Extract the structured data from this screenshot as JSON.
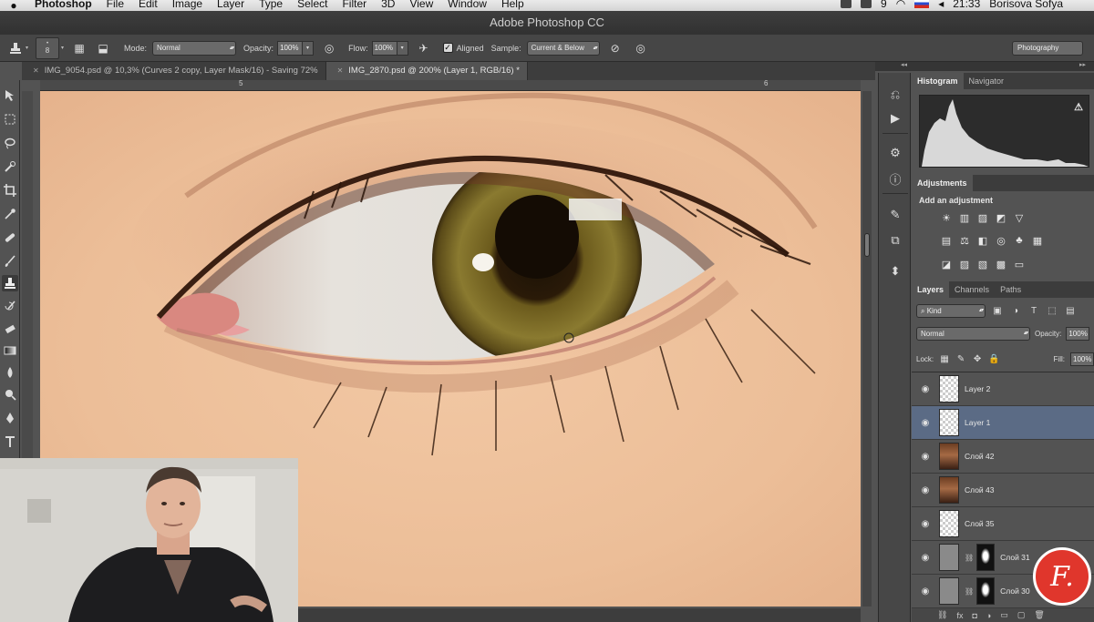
{
  "menubar": {
    "app": "Photoshop",
    "items": [
      "File",
      "Edit",
      "Image",
      "Layer",
      "Type",
      "Select",
      "Filter",
      "3D",
      "View",
      "Window",
      "Help"
    ],
    "status_number": "9",
    "time": "21:33",
    "user": "Borisova Sofya"
  },
  "window": {
    "title": "Adobe Photoshop CC"
  },
  "options": {
    "brush_size": "8",
    "mode_label": "Mode:",
    "mode_value": "Normal",
    "opacity_label": "Opacity:",
    "opacity_value": "100%",
    "flow_label": "Flow:",
    "flow_value": "100%",
    "aligned_label": "Aligned",
    "sample_label": "Sample:",
    "sample_value": "Current & Below",
    "workspace": "Photography"
  },
  "tabs": [
    {
      "label": "IMG_9054.psd @ 10,3% (Curves 2 copy, Layer Mask/16) - Saving 72%"
    },
    {
      "label": "IMG_2870.psd @ 200% (Layer 1, RGB/16) *"
    }
  ],
  "ruler": {
    "mark_a": "5",
    "mark_b": "6"
  },
  "panels": {
    "histogram_tab": "Histogram",
    "navigator_tab": "Navigator",
    "adjustments_tab": "Adjustments",
    "add_adjustment": "Add an adjustment",
    "layers_tab": "Layers",
    "channels_tab": "Channels",
    "paths_tab": "Paths",
    "kind_value": "Kind",
    "blend_mode": "Normal",
    "opacity_label": "Opacity:",
    "opacity_value": "100%",
    "lock_label": "Lock:",
    "fill_label": "Fill:",
    "fill_value": "100%"
  },
  "layers": [
    {
      "name": "Layer 2",
      "thumb": "checker",
      "selected": false
    },
    {
      "name": "Layer 1",
      "thumb": "checker",
      "selected": true
    },
    {
      "name": "Слой 42",
      "thumb": "photo",
      "selected": false
    },
    {
      "name": "Слой 43",
      "thumb": "photo",
      "selected": false
    },
    {
      "name": "Слой 35",
      "thumb": "checker",
      "selected": false
    },
    {
      "name": "Слой 31",
      "thumb": "mask",
      "selected": false
    },
    {
      "name": "Слой 30",
      "thumb": "mask",
      "selected": false
    }
  ],
  "logo": {
    "letter": "F."
  },
  "icons": {
    "tools": [
      "move-icon",
      "marquee-icon",
      "lasso-icon",
      "quick-select-icon",
      "crop-icon",
      "eyedropper-icon",
      "healing-brush-icon",
      "brush-icon",
      "clone-stamp-icon",
      "history-brush-icon",
      "eraser-icon",
      "gradient-icon",
      "blur-icon",
      "dodge-icon",
      "pen-icon",
      "type-icon"
    ],
    "dock": [
      "history-panel-icon",
      "actions-panel-icon",
      "properties-panel-icon",
      "info-panel-icon",
      "brush-presets-icon",
      "clone-source-icon",
      "tool-presets-icon"
    ]
  }
}
